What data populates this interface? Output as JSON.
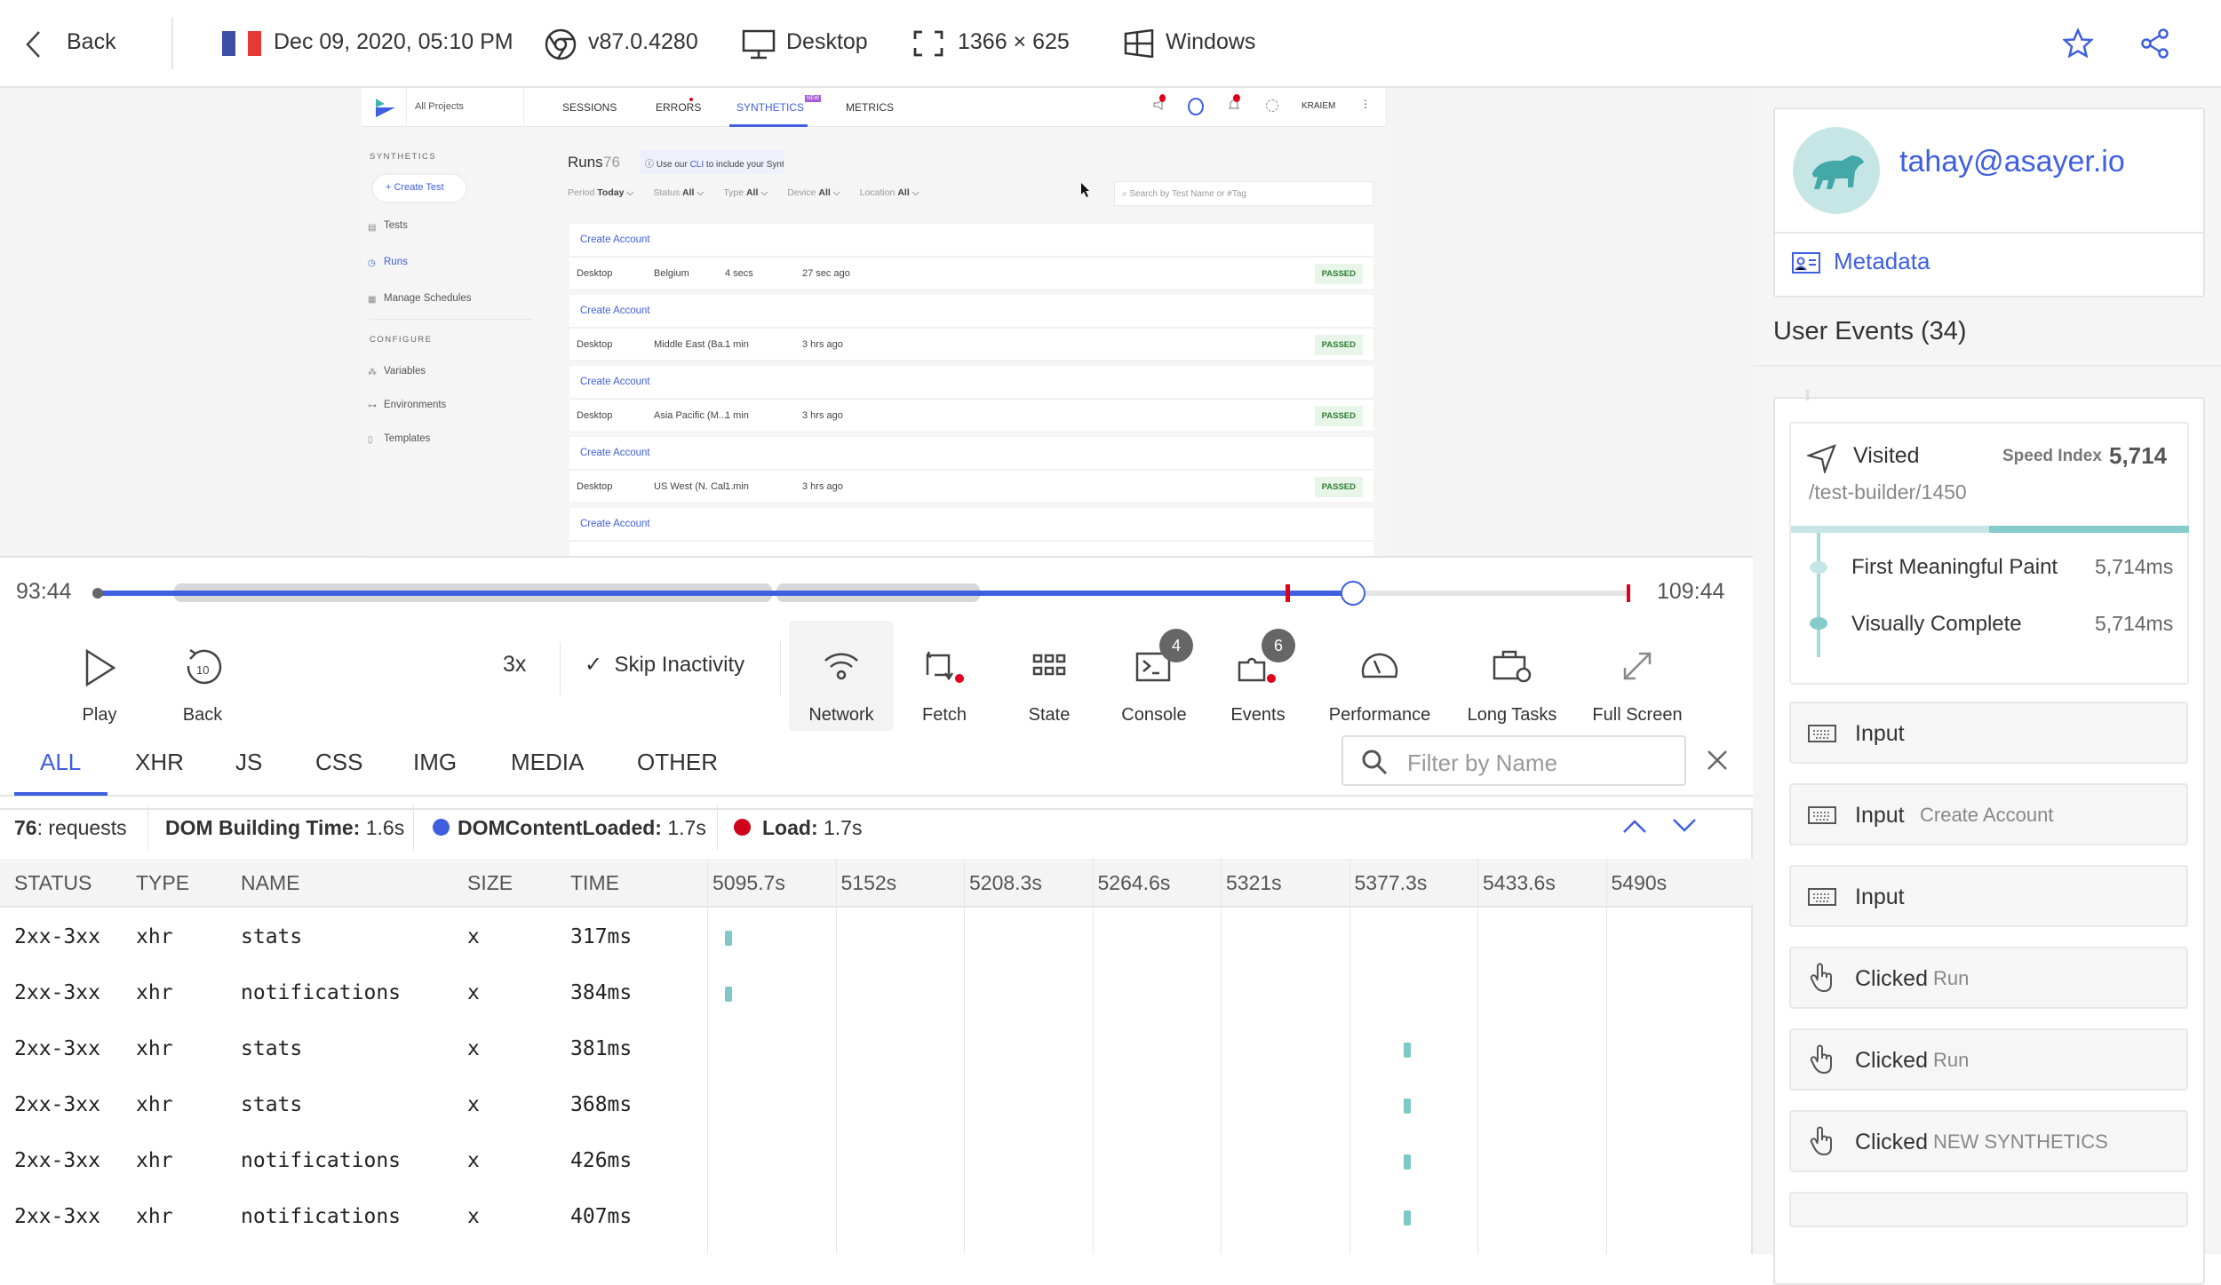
{
  "topbar": {
    "back": "Back",
    "date": "Dec 09, 2020, 05:10 PM",
    "browser": "v87.0.4280",
    "device": "Desktop",
    "resolution": "1366 × 625",
    "os": "Windows",
    "flag_colors": [
      "#3f4fa8",
      "#ffffff",
      "#e53935"
    ]
  },
  "mini": {
    "projects": "All Projects",
    "nav": [
      "SESSIONS",
      "ERRORS",
      "SYNTHETICS",
      "METRICS"
    ],
    "new_badge": "NEW",
    "user": "KRAIEM",
    "sidebar": {
      "section1": "SYNTHETICS",
      "create": "+ Create Test",
      "items": [
        "Tests",
        "Runs",
        "Manage Schedules"
      ],
      "section2": "CONFIGURE",
      "items2": [
        "Variables",
        "Environments",
        "Templates"
      ]
    },
    "runs_title": "Runs",
    "runs_count": "76",
    "info": {
      "pre": "Use our ",
      "link": "CLI",
      "post": " to include your Synthetics into your CI/CD pipeline."
    },
    "filters": [
      {
        "label": "Period",
        "value": "Today"
      },
      {
        "label": "Status",
        "value": "All"
      },
      {
        "label": "Type",
        "value": "All"
      },
      {
        "label": "Device",
        "value": "All"
      },
      {
        "label": "Location",
        "value": "All"
      }
    ],
    "search_placeholder": "Search by Test Name or #Tag",
    "runs": [
      {
        "name": "Create Account",
        "device": "Desktop",
        "location": "Belgium",
        "duration": "4 secs",
        "ago": "27 sec ago",
        "status": "PASSED"
      },
      {
        "name": "Create Account",
        "device": "Desktop",
        "location": "Middle East (Ba...",
        "duration": "1 min",
        "ago": "3 hrs ago",
        "status": "PASSED"
      },
      {
        "name": "Create Account",
        "device": "Desktop",
        "location": "Asia Pacific (M...",
        "duration": "1 min",
        "ago": "3 hrs ago",
        "status": "PASSED"
      },
      {
        "name": "Create Account",
        "device": "Desktop",
        "location": "US West (N. Cal...",
        "duration": "1 min",
        "ago": "3 hrs ago",
        "status": "PASSED"
      },
      {
        "name": "Create Account",
        "device": "",
        "location": "",
        "duration": "",
        "ago": "",
        "status": ""
      }
    ]
  },
  "player": {
    "start": "93:44",
    "end": "109:44",
    "progress_pct": 82,
    "speed": "3x",
    "skip": "Skip Inactivity",
    "controls": {
      "play": "Play",
      "back": "Back",
      "back_seconds": "10",
      "network": "Network",
      "fetch": "Fetch",
      "state": "State",
      "console": "Console",
      "console_count": "4",
      "events": "Events",
      "events_count": "6",
      "performance": "Performance",
      "long_tasks": "Long Tasks",
      "full_screen": "Full Screen"
    }
  },
  "network": {
    "tabs": [
      "ALL",
      "XHR",
      "JS",
      "CSS",
      "IMG",
      "MEDIA",
      "OTHER"
    ],
    "active_tab": "ALL",
    "filter_placeholder": "Filter by Name",
    "stats": {
      "requests_count": "76",
      "requests_label": ": requests",
      "dom_label": "DOM Building Time:",
      "dom_value": "1.6s",
      "dcl_label": "DOMContentLoaded:",
      "dcl_value": "1.7s",
      "load_label": "Load:",
      "load_value": "1.7s"
    },
    "columns": [
      "STATUS",
      "TYPE",
      "NAME",
      "SIZE",
      "TIME"
    ],
    "ticks": [
      "5095.7s",
      "5152s",
      "5208.3s",
      "5264.6s",
      "5321s",
      "5377.3s",
      "5433.6s",
      "5490s"
    ],
    "rows": [
      {
        "status": "2xx-3xx",
        "type": "xhr",
        "name": "stats",
        "size": "x",
        "time": "317ms"
      },
      {
        "status": "2xx-3xx",
        "type": "xhr",
        "name": "notifications",
        "size": "x",
        "time": "384ms"
      },
      {
        "status": "2xx-3xx",
        "type": "xhr",
        "name": "stats",
        "size": "x",
        "time": "381ms"
      },
      {
        "status": "2xx-3xx",
        "type": "xhr",
        "name": "stats",
        "size": "x",
        "time": "368ms"
      },
      {
        "status": "2xx-3xx",
        "type": "xhr",
        "name": "notifications",
        "size": "x",
        "time": "426ms"
      },
      {
        "status": "2xx-3xx",
        "type": "xhr",
        "name": "notifications",
        "size": "x",
        "time": "407ms"
      }
    ]
  },
  "side": {
    "email": "tahay@asayer.io",
    "metadata": "Metadata",
    "events_title": "User Events (34)",
    "visited": {
      "label": "Visited",
      "speed_label": "Speed Index",
      "speed": "5,714",
      "path": "/test-builder/1450",
      "fmp_label": "First Meaningful Paint",
      "fmp": "5,714ms",
      "vc_label": "Visually Complete",
      "vc": "5,714ms"
    },
    "events": [
      {
        "type": "Input",
        "value": ""
      },
      {
        "type": "Input",
        "value": "Create Account"
      },
      {
        "type": "Input",
        "value": ""
      },
      {
        "type": "Clicked",
        "value": "Run"
      },
      {
        "type": "Clicked",
        "value": "Run"
      },
      {
        "type": "Clicked",
        "value": "NEW SYNTHETICS"
      }
    ]
  },
  "colors": {
    "accent": "#3f5fe0",
    "teal": "#7ec8c8",
    "red": "#e0001b"
  }
}
